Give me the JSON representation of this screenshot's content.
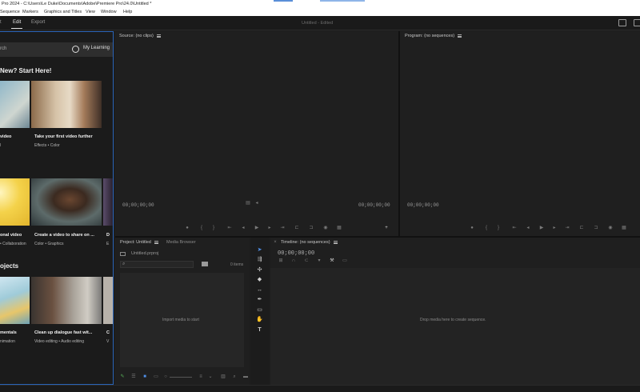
{
  "window": {
    "title": "Pro 2024 - C:\\Users\\Le Duke\\Documents\\Adobe\\Premiere Pro\\24.0\\Untitled *"
  },
  "menubar": {
    "items": [
      "Sequence",
      "Markers",
      "Graphics and Titles",
      "View",
      "Window",
      "Help"
    ]
  },
  "workspace": {
    "tabs": [
      "t",
      "Edit",
      "Export"
    ],
    "active_tab": "Edit",
    "project_title": "Untitled",
    "project_status": "- Edited"
  },
  "learn_panel": {
    "search_placeholder": "rch",
    "my_learning_label": "My Learning",
    "section_new": "New? Start Here!",
    "section_projects": "ojects",
    "cards_row1": [
      {
        "title": "video",
        "tags": "l"
      },
      {
        "title": "Take your first video further",
        "tags": "Effects  •  Color"
      }
    ],
    "cards_row2": [
      {
        "title": "onal video",
        "tags": "  •  Collaboration"
      },
      {
        "title": "Create a video to share on ...",
        "tags": "Color  •  Graphics"
      },
      {
        "title": "D",
        "tags": "E"
      }
    ],
    "cards_row3": [
      {
        "title": "mentals",
        "tags": "nimation"
      },
      {
        "title": "Clean up dialogue fast wit...",
        "tags": "Video editing  •  Audio editing"
      },
      {
        "title": "C",
        "tags": "V"
      }
    ]
  },
  "source_monitor": {
    "header": "Source: (no clips)",
    "timecode_left": "00;00;00;00",
    "timecode_right": "00;00;00;00"
  },
  "program_monitor": {
    "header": "Program: (no sequences)",
    "timecode_left": "00;00;00;00"
  },
  "project_panel": {
    "tab_active": "Project: Untitled",
    "tab_other": "Media Browser",
    "file_name": "Untitled.prproj",
    "item_count": "0 items",
    "empty_message": "Import media to start"
  },
  "timeline": {
    "header": "Timeline: (no sequences)",
    "timecode": "00;00;00;00",
    "empty_message": "Drop media here to create sequence."
  },
  "tools": [
    "selection-tool",
    "track-select-tool",
    "ripple-edit-tool",
    "razor-tool",
    "slip-tool",
    "pen-tool",
    "rectangle-tool",
    "hand-tool",
    "type-tool"
  ],
  "colors": {
    "accent_blue": "#2a64b8",
    "tool_active": "#4f8fe8"
  }
}
